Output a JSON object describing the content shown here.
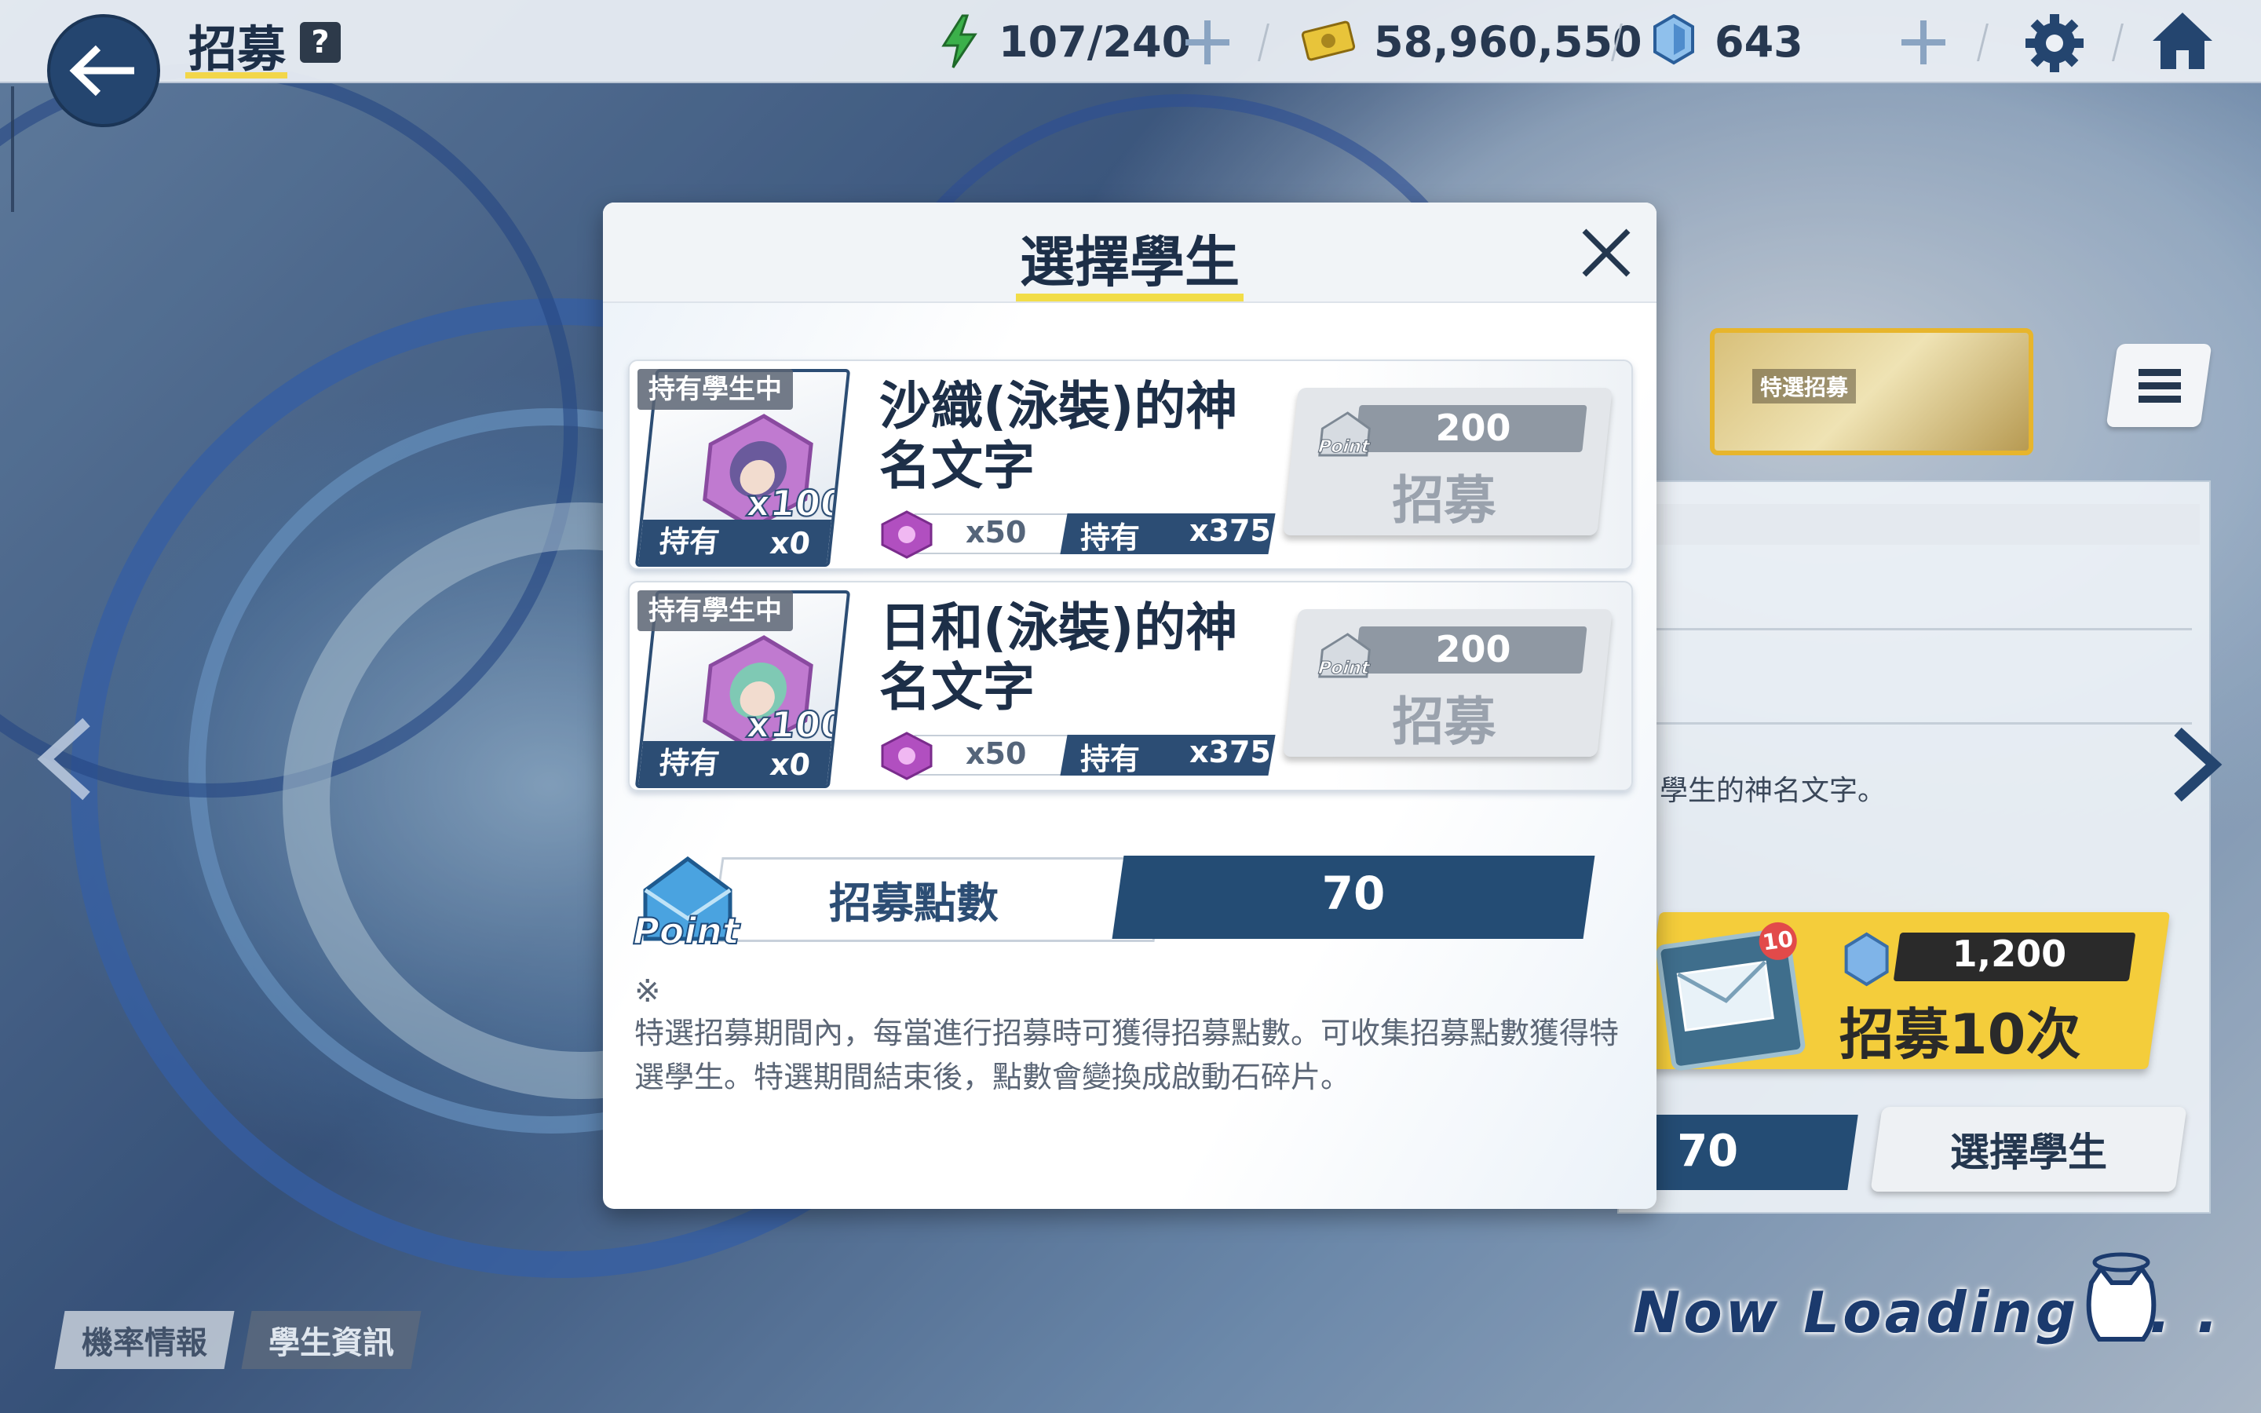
{
  "topbar": {
    "title": "招募",
    "help": "?",
    "ap": "107/240",
    "credits": "58,960,550",
    "gems": "643"
  },
  "modal": {
    "title": "選擇學生",
    "cards": [
      {
        "tag": "持有學生中",
        "portrait_count": "x100",
        "hold_label": "持有",
        "hold_value": "x0",
        "name": "沙織(泳裝)的神名文字",
        "shard_cost": "x50",
        "shard_hold_label": "持有",
        "shard_hold_value": "x375",
        "cost_icon": "Point",
        "cost": "200",
        "button": "招募",
        "avatar_color": "#6a5a9c"
      },
      {
        "tag": "持有學生中",
        "portrait_count": "x100",
        "hold_label": "持有",
        "hold_value": "x0",
        "name": "日和(泳裝)的神名文字",
        "shard_cost": "x50",
        "shard_hold_label": "持有",
        "shard_hold_value": "x375",
        "cost_icon": "Point",
        "cost": "200",
        "button": "招募",
        "avatar_color": "#7fc9b4"
      }
    ],
    "points": {
      "icon": "Point",
      "label": "招募點數",
      "value": "70"
    },
    "note_mark": "※",
    "note": "特選招募期間內，每當進行招募時可獲得招募點數。可收集招募點數獲得特選學生。特選期間結束後，點數會變換成啟動石碎片。"
  },
  "background": {
    "banner_label": "特選招募",
    "desc_fragment": "學生的神名文字。",
    "gacha_cost": "1,200",
    "gacha_button": "招募10次",
    "ticket_badge": "10",
    "points_value": "70",
    "select_button": "選擇學生",
    "tab_rates": "機率情報",
    "tab_students": "學生資訊",
    "loading": "Now Loading . . ."
  },
  "colors": {
    "navy": "#24456f",
    "yellow": "#f2d64a",
    "shard_purple": "#b14fc0"
  }
}
